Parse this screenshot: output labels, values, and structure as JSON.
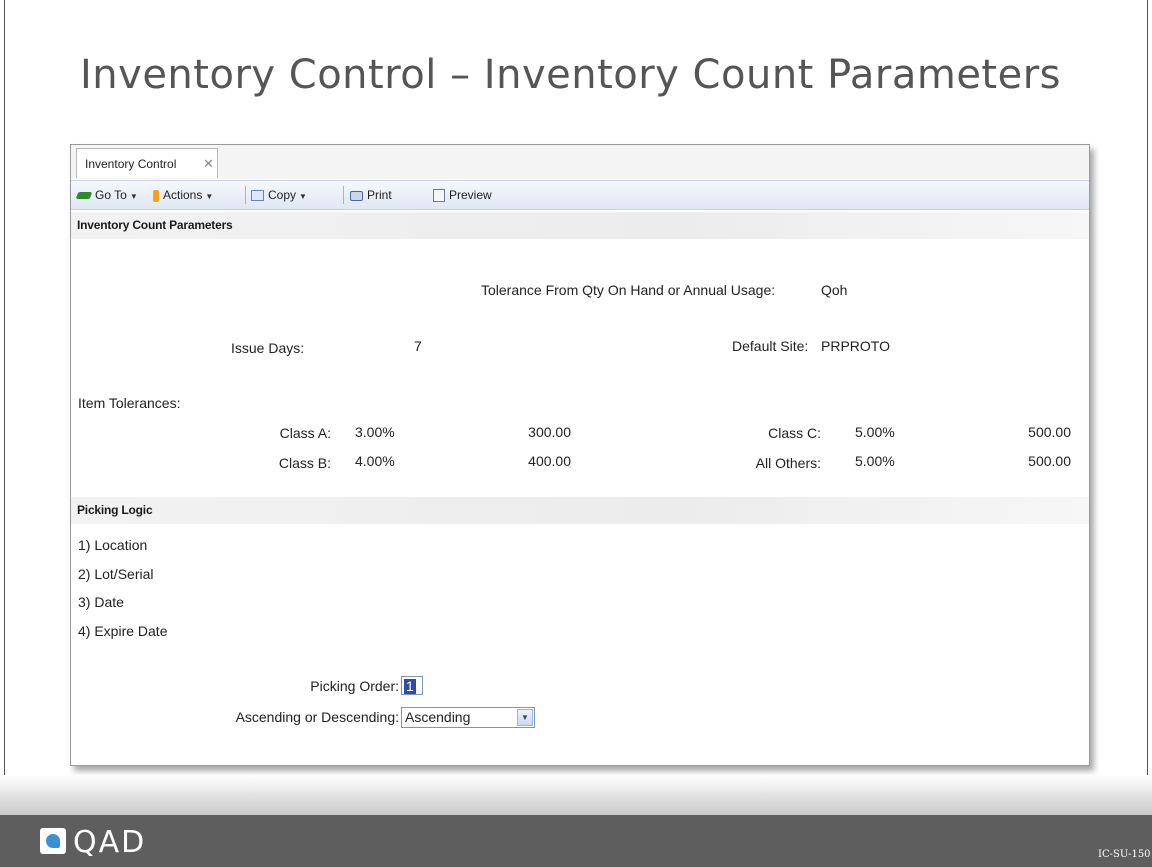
{
  "slide": {
    "title": "Inventory Control – Inventory Count Parameters",
    "code": "IC-SU-150"
  },
  "window": {
    "tab_label": "Inventory Control",
    "toolbar": {
      "goto": "Go To",
      "actions": "Actions",
      "copy": "Copy",
      "print": "Print",
      "preview": "Preview"
    }
  },
  "params": {
    "section_title": "Inventory Count Parameters",
    "tolerance_label": "Tolerance From Qty On Hand or Annual Usage:",
    "tolerance_value": "Qoh",
    "issue_days_label": "Issue Days:",
    "issue_days_value": "7",
    "default_site_label": "Default Site:",
    "default_site_value": "PRPROTO",
    "item_tolerances_label": "Item Tolerances:",
    "class_a": {
      "label": "Class A:",
      "pct": "3.00%",
      "amount": "300.00"
    },
    "class_b": {
      "label": "Class B:",
      "pct": "4.00%",
      "amount": "400.00"
    },
    "class_c": {
      "label": "Class C:",
      "pct": "5.00%",
      "amount": "500.00"
    },
    "all_others": {
      "label": "All Others:",
      "pct": "5.00%",
      "amount": "500.00"
    }
  },
  "picking": {
    "section_title": "Picking Logic",
    "items": [
      "1) Location",
      "2) Lot/Serial",
      "3) Date",
      "4) Expire Date"
    ],
    "order_label": "Picking Order:",
    "order_value": "1",
    "direction_label": "Ascending or Descending:",
    "direction_value": "Ascending"
  },
  "footer": {
    "logo_text": "QAD"
  }
}
